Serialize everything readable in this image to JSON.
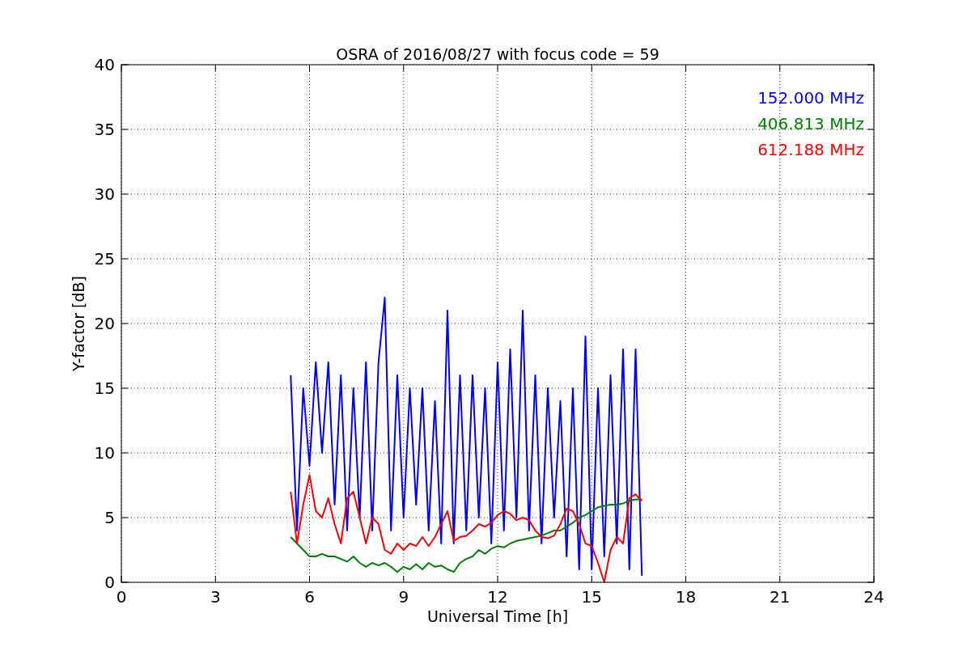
{
  "chart_data": {
    "type": "line",
    "title": "OSRA of 2016/08/27 with focus code = 59",
    "xlabel": "Universal Time [h]",
    "ylabel": "Y-factor [dB]",
    "x": [
      5.4,
      5.6,
      5.8,
      6.0,
      6.2,
      6.4,
      6.6,
      6.8,
      7.0,
      7.2,
      7.4,
      7.6,
      7.8,
      8.0,
      8.2,
      8.4,
      8.6,
      8.8,
      9.0,
      9.2,
      9.4,
      9.6,
      9.8,
      10.0,
      10.2,
      10.4,
      10.6,
      10.8,
      11.0,
      11.2,
      11.4,
      11.6,
      11.8,
      12.0,
      12.2,
      12.4,
      12.6,
      12.8,
      13.0,
      13.2,
      13.4,
      13.6,
      13.8,
      14.0,
      14.2,
      14.4,
      14.6,
      14.8,
      15.0,
      15.2,
      15.4,
      15.6,
      15.8,
      16.0,
      16.2,
      16.4,
      16.6
    ],
    "series": [
      {
        "name": "152.000 MHz",
        "color": "#0000ff",
        "values": [
          16,
          4,
          15,
          9,
          17,
          10,
          17,
          6,
          16,
          4,
          15,
          5,
          17,
          4,
          17,
          22,
          4,
          16,
          5,
          15,
          6,
          15,
          4,
          14,
          3,
          21,
          3,
          16,
          4,
          16,
          5,
          15,
          3,
          17,
          4,
          18,
          5,
          21,
          4,
          16,
          3,
          15,
          5,
          14,
          2,
          15,
          1,
          19,
          1,
          15,
          2,
          16,
          3,
          18,
          1,
          18,
          0.5
        ]
      },
      {
        "name": "406.813 MHz",
        "color": "#008000",
        "values": [
          3.5,
          3,
          2.5,
          2,
          2,
          2.2,
          2,
          2,
          1.8,
          1.6,
          2,
          1.5,
          1.2,
          1.5,
          1.3,
          1.5,
          1.2,
          0.8,
          1.2,
          1,
          1.4,
          1,
          1.5,
          1.2,
          1.3,
          1,
          0.8,
          1.5,
          1.8,
          2,
          2.5,
          2.2,
          2.6,
          2.8,
          2.7,
          3,
          3.2,
          3.3,
          3.4,
          3.5,
          3.6,
          3.8,
          4,
          4,
          4.3,
          4.6,
          5,
          5.2,
          5.5,
          5.8,
          5.9,
          6,
          6,
          6.1,
          6.3,
          6.4,
          6.4
        ]
      },
      {
        "name": "612.188 MHz",
        "color": "#ff0000",
        "values": [
          7,
          3,
          6,
          8.3,
          5.5,
          5,
          6.5,
          4.5,
          3,
          6.5,
          7,
          5,
          3,
          5,
          4.5,
          2.5,
          2.2,
          3,
          2.5,
          3,
          2.8,
          3.5,
          2.8,
          3.5,
          4.5,
          5.5,
          3.2,
          3.5,
          3.6,
          4,
          4.5,
          4.3,
          4.6,
          5.2,
          5.5,
          5.3,
          4.8,
          5,
          4.8,
          4,
          3.5,
          3.4,
          3.6,
          4.5,
          5.7,
          5.5,
          4.5,
          3,
          2.8,
          1.5,
          0,
          2.5,
          3.5,
          3,
          6.5,
          6.8,
          6.3
        ]
      }
    ],
    "xlim": [
      0,
      24
    ],
    "ylim": [
      0,
      40
    ],
    "xticks": [
      0,
      3,
      6,
      9,
      12,
      15,
      18,
      21,
      24
    ],
    "yticks": [
      0,
      5,
      10,
      15,
      20,
      25,
      30,
      35,
      40
    ],
    "grid": true
  }
}
